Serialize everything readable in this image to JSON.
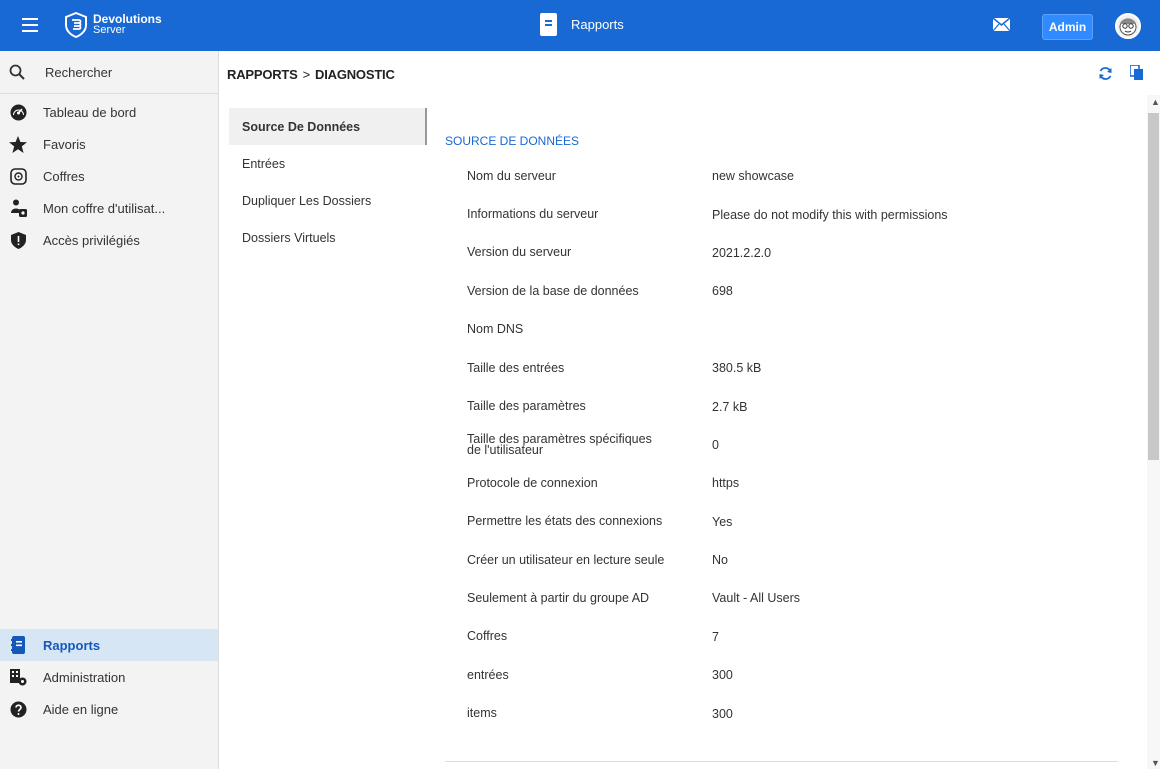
{
  "header": {
    "logo_line1": "Devolutions",
    "logo_line2": "Server",
    "title": "Rapports",
    "admin_label": "Admin"
  },
  "sidebar": {
    "search_label": "Rechercher",
    "items": [
      {
        "label": "Tableau de bord",
        "icon": "dashboard-icon"
      },
      {
        "label": "Favoris",
        "icon": "star-icon"
      },
      {
        "label": "Coffres",
        "icon": "vault-icon"
      },
      {
        "label": "Mon coffre d'utilisat...",
        "icon": "user-vault-icon"
      },
      {
        "label": "Accès privilégiés",
        "icon": "shield-icon"
      }
    ],
    "bottom_items": [
      {
        "label": "Rapports",
        "icon": "reports-icon",
        "active": true
      },
      {
        "label": "Administration",
        "icon": "administration-icon"
      },
      {
        "label": "Aide en ligne",
        "icon": "help-icon"
      }
    ]
  },
  "breadcrumb": {
    "part1": "RAPPORTS",
    "separator": ">",
    "part2": "DIAGNOSTIC"
  },
  "subnav": [
    {
      "label": "Source De Données",
      "active": true
    },
    {
      "label": "Entrées"
    },
    {
      "label": "Dupliquer Les Dossiers"
    },
    {
      "label": "Dossiers Virtuels"
    }
  ],
  "content": {
    "section_title": "SOURCE DE DONNÉES",
    "rows": [
      {
        "key": "Nom du serveur",
        "value": "new showcase"
      },
      {
        "key": "Informations du serveur",
        "value": "Please do not modify this with permissions"
      },
      {
        "key": "Version du serveur",
        "value": "2021.2.2.0"
      },
      {
        "key": "Version de la base de données",
        "value": "698"
      },
      {
        "key": "Nom DNS",
        "value": ""
      },
      {
        "key": "Taille des entrées",
        "value": "380.5 kB"
      },
      {
        "key": "Taille des paramètres",
        "value": "2.7 kB"
      },
      {
        "key": "Taille des paramètres spécifiques de l'utilisateur",
        "value": "0"
      },
      {
        "key": "Protocole de connexion",
        "value": "https"
      },
      {
        "key": "Permettre les états des connexions",
        "value": "Yes"
      },
      {
        "key": "Créer un utilisateur en lecture seule",
        "value": "No"
      },
      {
        "key": "Seulement à partir du groupe AD",
        "value": "Vault - All Users"
      },
      {
        "key": "Coffres",
        "value": "7"
      },
      {
        "key": "entrées",
        "value": "300"
      },
      {
        "key": "items",
        "value": "300"
      }
    ]
  },
  "colors": {
    "topbar": "#1869d3",
    "accent": "#1869d3",
    "active_nav_bg": "#d7e6f5"
  }
}
